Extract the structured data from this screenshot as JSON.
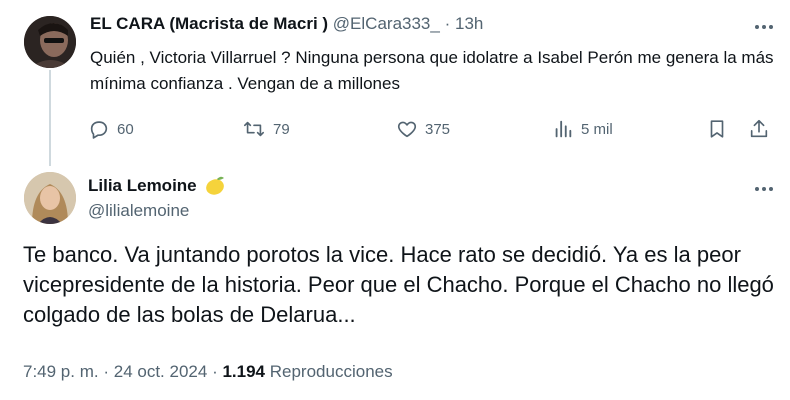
{
  "parent_tweet": {
    "display_name": "EL CARA (Macrista de Macri )",
    "handle": "@ElCara333_",
    "separator": "·",
    "time": "13h",
    "text": "Quién , Victoria Villarruel ? Ninguna persona que idolatre a Isabel Perón me genera la más mínima confianza . Vengan de a millones",
    "actions": {
      "replies": "60",
      "reposts": "79",
      "likes": "375",
      "views": "5 mil"
    }
  },
  "reply_tweet": {
    "display_name": "Lilia Lemoine",
    "name_emoji": "lemon-emoji",
    "handle": "@lilialemoine",
    "text": "Te banco. Va juntando porotos la vice. Hace rato se decidió. Ya es la peor vicepresidente de la historia. Peor que el Chacho. Porque el Chacho no llegó colgado de las bolas de Delarua...",
    "meta": {
      "time": "7:49 p. m.",
      "sep1": "·",
      "date": "24 oct. 2024",
      "sep2": "·",
      "views_count": "1.194",
      "views_label": "Reproducciones"
    }
  },
  "colors": {
    "text": "#0f1419",
    "muted": "#536471",
    "thread_line": "#cfd9de",
    "background": "#ffffff"
  }
}
